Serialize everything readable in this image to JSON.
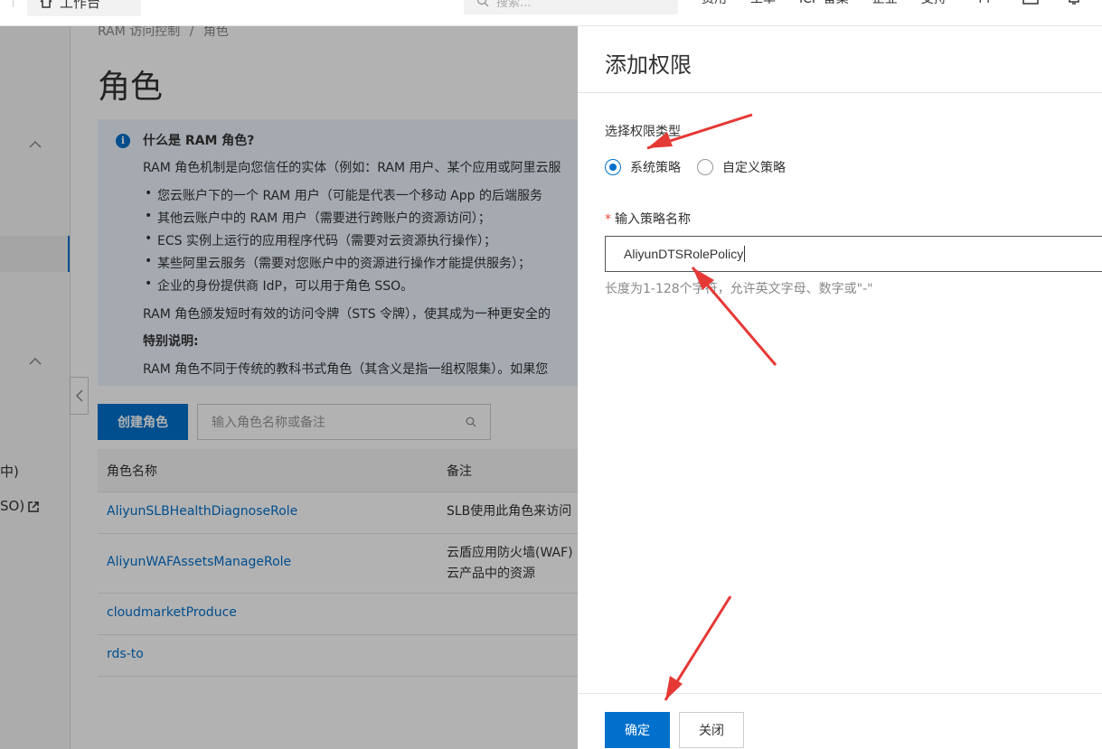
{
  "topbar": {
    "workbench_label": "工作台",
    "search_placeholder": "搜索...",
    "nav": [
      "费用",
      "工单",
      "ICP 备案",
      "企业",
      "支持",
      "App"
    ]
  },
  "sidebar": {
    "partial_items": [
      "中)",
      "SO)"
    ]
  },
  "main": {
    "breadcrumb": [
      "RAM 访问控制",
      "/",
      "角色"
    ],
    "page_title": "角色",
    "info": {
      "title": "什么是 RAM 角色?",
      "intro": "RAM 角色机制是向您信任的实体（例如：RAM 用户、某个应用或阿里云服",
      "bullets": [
        "您云账户下的一个 RAM 用户（可能是代表一个移动 App 的后端服务",
        "其他云账户中的 RAM 用户（需要进行跨账户的资源访问）；",
        "ECS 实例上运行的应用程序代码（需要对云资源执行操作）；",
        "某些阿里云服务（需要对您账户中的资源进行操作才能提供服务）；",
        "企业的身份提供商 IdP，可以用于角色 SSO。"
      ],
      "sts_line": "RAM 角色颁发短时有效的访问令牌（STS 令牌），使其成为一种更安全的",
      "special_title": "特别说明:",
      "special_line": "RAM 角色不同于传统的教科书式角色（其含义是指一组权限集）。如果您"
    },
    "create_button": "创建角色",
    "search_placeholder": "输入角色名称或备注",
    "table": {
      "headers": [
        "角色名称",
        "备注"
      ],
      "rows": [
        {
          "name": "AliyunSLBHealthDiagnoseRole",
          "note": [
            "SLB使用此角色来访问"
          ]
        },
        {
          "name": "AliyunWAFAssetsManageRole",
          "note": [
            "云盾应用防火墙(WAF)",
            "云产品中的资源"
          ]
        },
        {
          "name": "cloudmarketProduce",
          "note": []
        },
        {
          "name": "rds-to",
          "note": []
        }
      ]
    }
  },
  "drawer": {
    "title": "添加权限",
    "type_label": "选择权限类型",
    "radio_system": "系统策略",
    "radio_custom": "自定义策略",
    "selected_type": "系统策略",
    "name_label": "输入策略名称",
    "name_value": "AliyunDTSRolePolicy",
    "hint": "长度为1-128个字符，允许英文字母、数字或\"-\"",
    "ok_button": "确定",
    "close_button": "关闭"
  },
  "colors": {
    "primary": "#0070cc",
    "required": "#e84738",
    "annotation_arrow": "#e53935"
  }
}
